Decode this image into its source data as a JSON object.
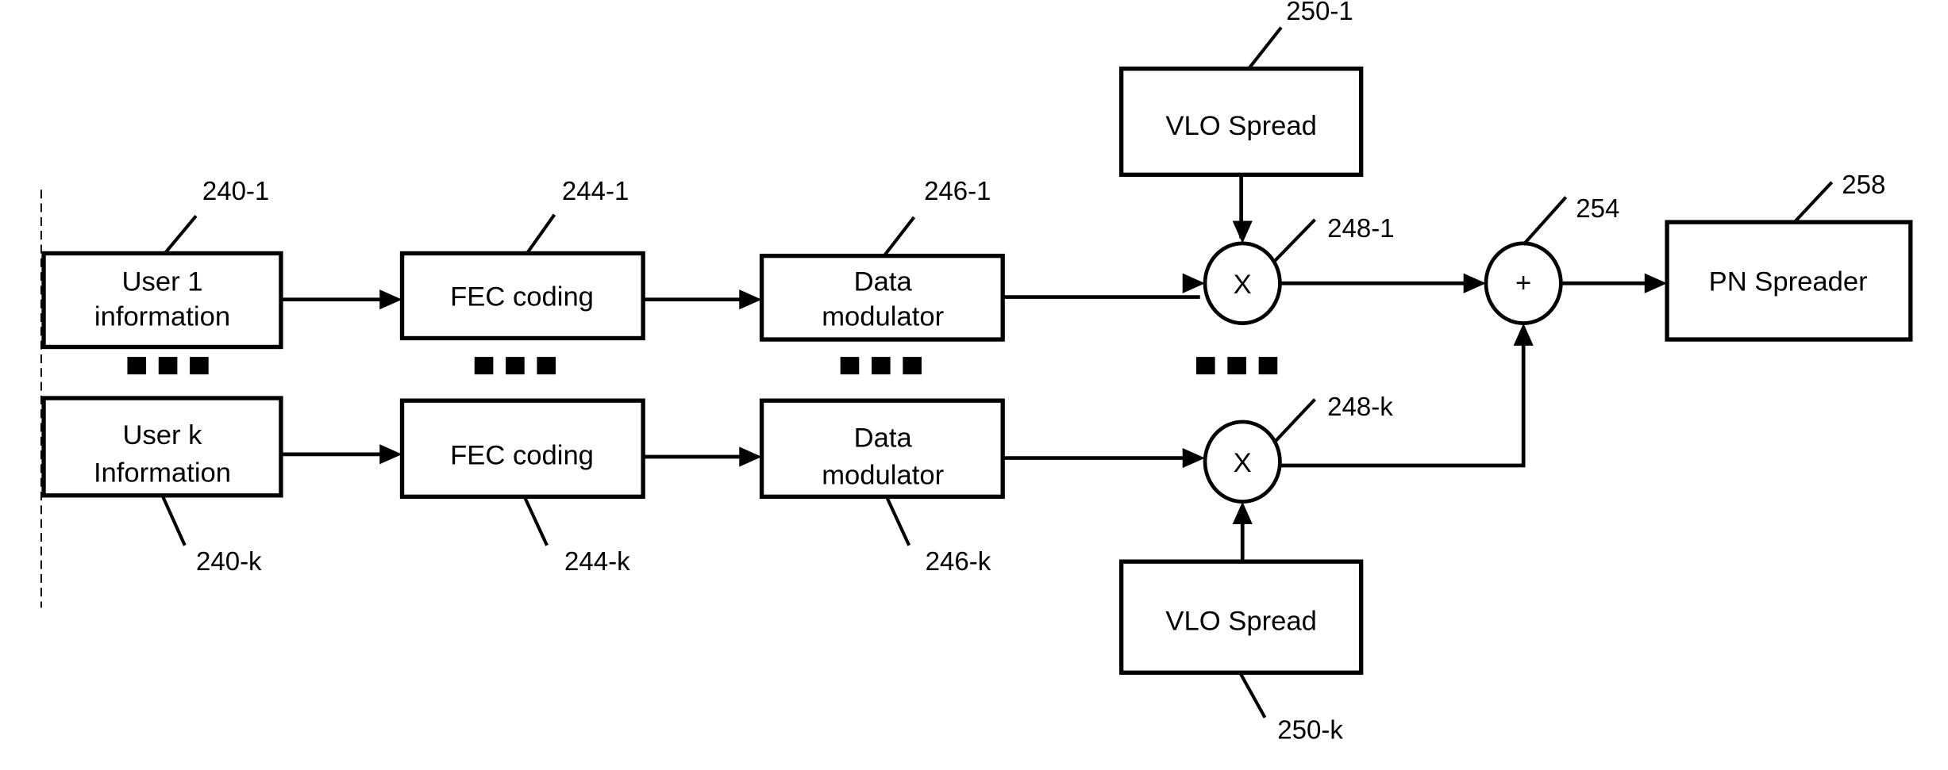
{
  "figure": {
    "rows": [
      {
        "user": {
          "lines": [
            "User 1",
            "information"
          ],
          "ref": "240-1"
        },
        "fec": {
          "lines": [
            "FEC coding"
          ],
          "ref": "244-1"
        },
        "modulator": {
          "lines": [
            "Data",
            "modulator"
          ],
          "ref": "246-1"
        },
        "multiplier": {
          "symbol": "X",
          "ref": "248-1"
        },
        "vlo": {
          "lines": [
            "VLO Spread"
          ],
          "ref": "250-1"
        }
      },
      {
        "user": {
          "lines": [
            "User k",
            "Information"
          ],
          "ref": "240-k"
        },
        "fec": {
          "lines": [
            "FEC coding"
          ],
          "ref": "244-k"
        },
        "modulator": {
          "lines": [
            "Data",
            "modulator"
          ],
          "ref": "246-k"
        },
        "multiplier": {
          "symbol": "X",
          "ref": "248-k"
        },
        "vlo": {
          "lines": [
            "VLO Spread"
          ],
          "ref": "250-k"
        }
      }
    ],
    "adder": {
      "symbol": "+",
      "ref": "254"
    },
    "pn_spreader": {
      "lines": [
        "PN Spreader"
      ],
      "ref": "258"
    },
    "ellipsis_marker": "■ ■ ■"
  }
}
